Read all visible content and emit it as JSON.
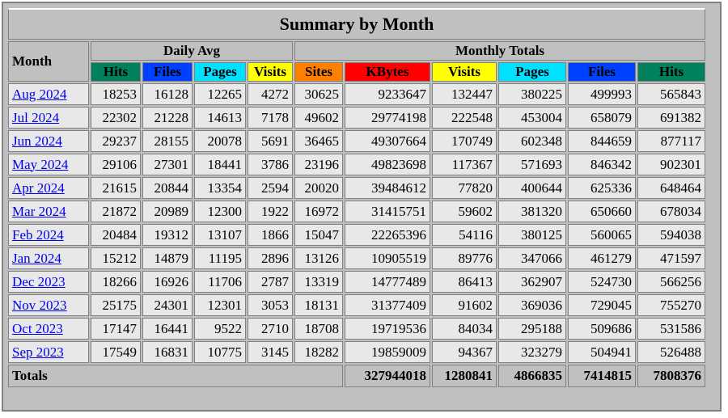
{
  "title": "Summary by Month",
  "headers": {
    "month": "Month",
    "daily_avg": "Daily Avg",
    "monthly_totals": "Monthly Totals",
    "daily": [
      "Hits",
      "Files",
      "Pages",
      "Visits"
    ],
    "monthly": [
      "Sites",
      "KBytes",
      "Visits",
      "Pages",
      "Files",
      "Hits"
    ]
  },
  "colors": {
    "hits": "#00805c",
    "files": "#0040ff",
    "pages": "#00e0ff",
    "visits": "#ffff00",
    "sites": "#ff8000",
    "kbytes": "#ff0000"
  },
  "rows": [
    {
      "month": "Aug 2024",
      "d_hits": "18253",
      "d_files": "16128",
      "d_pages": "12265",
      "d_visits": "4272",
      "sites": "30625",
      "kbytes": "9233647",
      "visits": "132447",
      "pages": "380225",
      "files": "499993",
      "hits": "565843"
    },
    {
      "month": "Jul 2024",
      "d_hits": "22302",
      "d_files": "21228",
      "d_pages": "14613",
      "d_visits": "7178",
      "sites": "49602",
      "kbytes": "29774198",
      "visits": "222548",
      "pages": "453004",
      "files": "658079",
      "hits": "691382"
    },
    {
      "month": "Jun 2024",
      "d_hits": "29237",
      "d_files": "28155",
      "d_pages": "20078",
      "d_visits": "5691",
      "sites": "36465",
      "kbytes": "49307664",
      "visits": "170749",
      "pages": "602348",
      "files": "844659",
      "hits": "877117"
    },
    {
      "month": "May 2024",
      "d_hits": "29106",
      "d_files": "27301",
      "d_pages": "18441",
      "d_visits": "3786",
      "sites": "23196",
      "kbytes": "49823698",
      "visits": "117367",
      "pages": "571693",
      "files": "846342",
      "hits": "902301"
    },
    {
      "month": "Apr 2024",
      "d_hits": "21615",
      "d_files": "20844",
      "d_pages": "13354",
      "d_visits": "2594",
      "sites": "20020",
      "kbytes": "39484612",
      "visits": "77820",
      "pages": "400644",
      "files": "625336",
      "hits": "648464"
    },
    {
      "month": "Mar 2024",
      "d_hits": "21872",
      "d_files": "20989",
      "d_pages": "12300",
      "d_visits": "1922",
      "sites": "16972",
      "kbytes": "31415751",
      "visits": "59602",
      "pages": "381320",
      "files": "650660",
      "hits": "678034"
    },
    {
      "month": "Feb 2024",
      "d_hits": "20484",
      "d_files": "19312",
      "d_pages": "13107",
      "d_visits": "1866",
      "sites": "15047",
      "kbytes": "22265396",
      "visits": "54116",
      "pages": "380125",
      "files": "560065",
      "hits": "594038"
    },
    {
      "month": "Jan 2024",
      "d_hits": "15212",
      "d_files": "14879",
      "d_pages": "11195",
      "d_visits": "2896",
      "sites": "13126",
      "kbytes": "10905519",
      "visits": "89776",
      "pages": "347066",
      "files": "461279",
      "hits": "471597"
    },
    {
      "month": "Dec 2023",
      "d_hits": "18266",
      "d_files": "16926",
      "d_pages": "11706",
      "d_visits": "2787",
      "sites": "13319",
      "kbytes": "14777489",
      "visits": "86413",
      "pages": "362907",
      "files": "524730",
      "hits": "566256"
    },
    {
      "month": "Nov 2023",
      "d_hits": "25175",
      "d_files": "24301",
      "d_pages": "12301",
      "d_visits": "3053",
      "sites": "18131",
      "kbytes": "31377409",
      "visits": "91602",
      "pages": "369036",
      "files": "729045",
      "hits": "755270"
    },
    {
      "month": "Oct 2023",
      "d_hits": "17147",
      "d_files": "16441",
      "d_pages": "9522",
      "d_visits": "2710",
      "sites": "18708",
      "kbytes": "19719536",
      "visits": "84034",
      "pages": "295188",
      "files": "509686",
      "hits": "531586"
    },
    {
      "month": "Sep 2023",
      "d_hits": "17549",
      "d_files": "16831",
      "d_pages": "10775",
      "d_visits": "3145",
      "sites": "18282",
      "kbytes": "19859009",
      "visits": "94367",
      "pages": "323279",
      "files": "504941",
      "hits": "526488"
    }
  ],
  "totals": {
    "label": "Totals",
    "kbytes": "327944018",
    "visits": "1280841",
    "pages": "4866835",
    "files": "7414815",
    "hits": "7808376"
  }
}
